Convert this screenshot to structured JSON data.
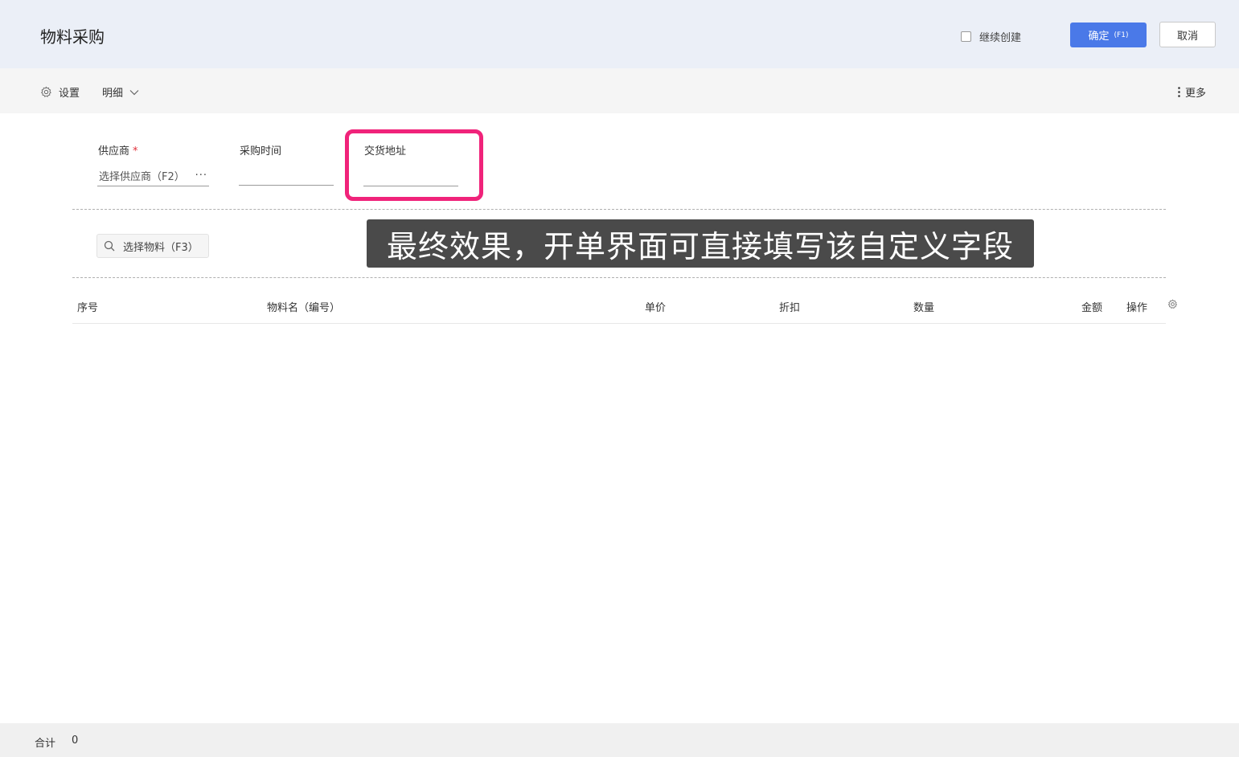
{
  "header": {
    "title": "物料采购",
    "keep_creating_label": "继续创建",
    "keep_creating_checked": false,
    "confirm_label": "确定",
    "confirm_shortcut": "(F1)",
    "cancel_label": "取消"
  },
  "toolbar": {
    "settings_label": "设置",
    "detail_label": "明细",
    "more_label": "更多"
  },
  "form": {
    "supplier": {
      "label": "供应商",
      "required_mark": "*",
      "placeholder": "选择供应商（F2）",
      "more": "···"
    },
    "purchase_time": {
      "label": "采购时间",
      "value": ""
    },
    "delivery_address": {
      "label": "交货地址",
      "value": ""
    }
  },
  "material_search": {
    "placeholder": "选择物料（F3）"
  },
  "caption": "最终效果，开单界面可直接填写该自定义字段",
  "table": {
    "columns": [
      "序号",
      "物料名（编号）",
      "单价",
      "折扣",
      "数量",
      "金额",
      "操作"
    ],
    "rows": []
  },
  "footer": {
    "total_label": "合计",
    "total_value": "0"
  },
  "colors": {
    "accent": "#4a79e8",
    "highlight": "#f0237a",
    "header_bg": "#ebeff7"
  }
}
